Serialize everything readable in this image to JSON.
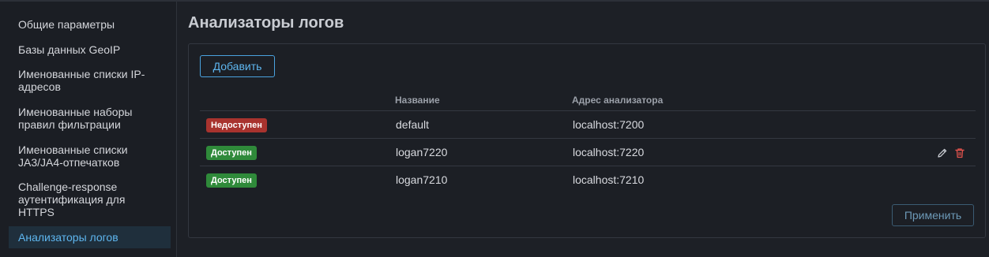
{
  "sidebar": {
    "items": [
      {
        "label": "Общие параметры"
      },
      {
        "label": "Базы данных GeoIP"
      },
      {
        "label": "Именованные списки IP-адресов"
      },
      {
        "label": "Именованные наборы правил фильтрации"
      },
      {
        "label": "Именованные списки JA3/JA4-отпечатков"
      },
      {
        "label": "Challenge-response аутентификация для HTTPS"
      },
      {
        "label": "Анализаторы логов"
      }
    ]
  },
  "page": {
    "title": "Анализаторы логов",
    "add_label": "Добавить",
    "apply_label": "Применить"
  },
  "table": {
    "columns": [
      "",
      "Название",
      "Адрес анализатора"
    ],
    "rows": [
      {
        "status": "Недоступен",
        "status_kind": "unavailable",
        "name": "default",
        "address": "localhost:7200"
      },
      {
        "status": "Доступен",
        "status_kind": "available",
        "name": "logan7220",
        "address": "localhost:7220",
        "actions": [
          "pencil-icon",
          "trash-icon"
        ]
      },
      {
        "status": "Доступен",
        "status_kind": "available",
        "name": "logan7210",
        "address": "localhost:7210"
      }
    ]
  },
  "colors": {
    "accent": "#5eb6ef",
    "status_unavailable": "#a8332e",
    "status_available": "#2f8a3a",
    "delete": "#e0524c"
  }
}
